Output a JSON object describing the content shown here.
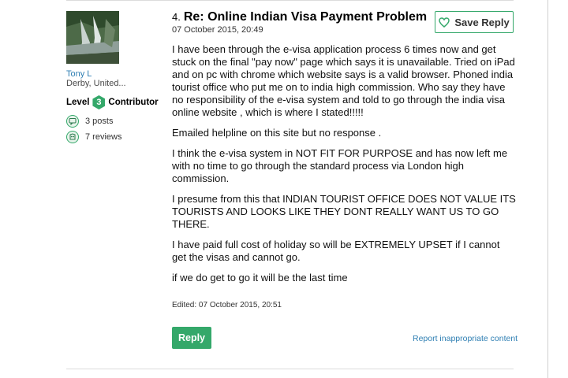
{
  "author": {
    "name": "Tony L",
    "location": "Derby, United...",
    "level_prefix": "Level",
    "level_number": "3",
    "level_suffix": "Contributor",
    "posts": "3 posts",
    "reviews": "7 reviews",
    "accent_color": "#34a86a"
  },
  "post": {
    "number": "4.",
    "title": "Re: Online Indian Visa Payment Problem",
    "date": "07 October 2015, 20:49",
    "save_label": "Save Reply",
    "paragraphs": [
      "I have been through the e-visa application process 6 times now and get stuck on the final \"pay now\" page which says it is unavailable. Tried on iPad and on pc with chrome which website says is a valid browser. Phoned india tourist office who put me on to india high commission. Who say they have no responsibility of the e-visa system and told to go through the india visa online website , which is where I stated!!!!!",
      "Emailed helpline on this site but no response .",
      "I think the e-visa system in NOT FIT FOR PURPOSE and has now left me with no time to go through the standard process via London high commission.",
      "I presume from this that INDIAN TOURIST OFFICE DOES NOT VALUE ITS TOURISTS AND LOOKS LIKE THEY DONT REALLY WANT US TO GO THERE.",
      "I have paid full cost of holiday so will be EXTREMELY UPSET if I cannot get the visas and cannot go.",
      "if we do get to go it will be the last time"
    ],
    "edited": "Edited: 07 October 2015, 20:51",
    "reply_label": "Reply",
    "report_label": "Report inappropriate content"
  },
  "icons": {
    "save": "heart-icon",
    "posts": "speech-bubble-icon",
    "reviews": "owl-icon",
    "level": "level-badge-icon"
  }
}
